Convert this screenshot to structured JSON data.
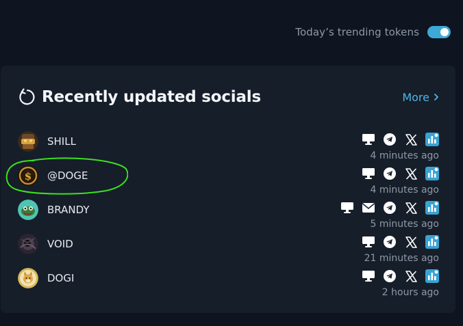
{
  "header": {
    "trending_label": "Today’s trending tokens",
    "trending_toggle_on": true
  },
  "card": {
    "title": "Recently updated socials",
    "more_label": "More",
    "more_icon": "chevron-right-icon"
  },
  "rows": [
    {
      "name": "SHILL",
      "time_ago": "4 minutes ago",
      "socials": [
        "website",
        "telegram",
        "x",
        "dexscreener"
      ]
    },
    {
      "name": "@DOGE",
      "time_ago": "4 minutes ago",
      "socials": [
        "website",
        "telegram",
        "x",
        "dexscreener"
      ]
    },
    {
      "name": "BRANDY",
      "time_ago": "5 minutes ago",
      "socials": [
        "website",
        "email",
        "telegram",
        "x",
        "dexscreener"
      ]
    },
    {
      "name": "VOID",
      "time_ago": "21 minutes ago",
      "socials": [
        "website",
        "telegram",
        "x",
        "dexscreener"
      ]
    },
    {
      "name": "DOGI",
      "time_ago": "2 hours ago",
      "socials": [
        "website",
        "telegram",
        "x",
        "dexscreener"
      ]
    }
  ],
  "colors": {
    "background": "#0e1520",
    "card": "#161e2a",
    "accent": "#4fb6e3",
    "highlight": "#3ee11c"
  }
}
